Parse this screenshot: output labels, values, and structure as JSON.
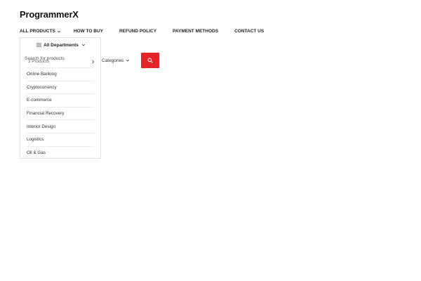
{
  "brand": {
    "logo": "ProgrammerX"
  },
  "nav": {
    "items": [
      {
        "label": "ALL PRODUCTS",
        "has_dropdown": true
      },
      {
        "label": "HOW TO BUY"
      },
      {
        "label": "REFUND POLICY"
      },
      {
        "label": "PAYMENT METHODS"
      },
      {
        "label": "CONTACT US"
      }
    ]
  },
  "departments": {
    "header": "All Departments",
    "first_item": "3 Products",
    "items": [
      "Online Banking",
      "Cryptocurrency",
      "E-commerce",
      "Financial Recovery",
      "Interior Design",
      "Logistics",
      "Oil & Gas"
    ]
  },
  "search": {
    "placeholder": "Search for products",
    "category_label": "Categories",
    "button_icon": "search-icon"
  },
  "colors": {
    "accent": "#e22628",
    "text": "#222222",
    "border": "#e2e2e2"
  }
}
